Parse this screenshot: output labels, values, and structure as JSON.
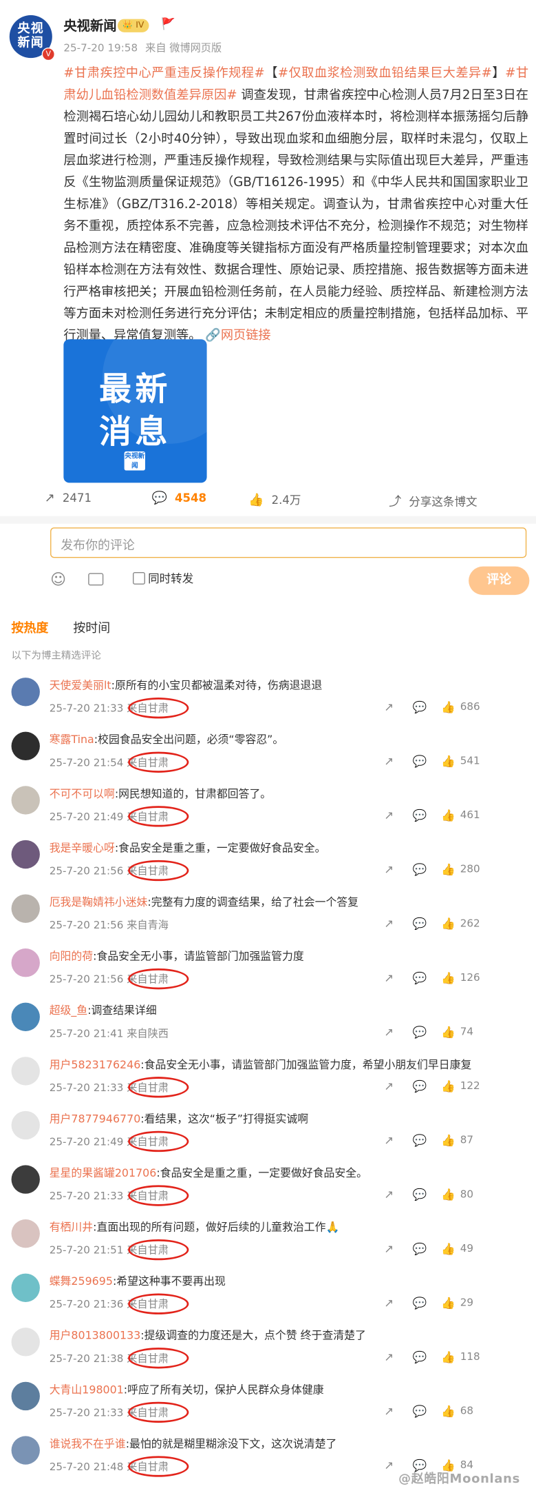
{
  "account": {
    "avatar_text_top": "央视",
    "avatar_text_bottom": "新闻",
    "name": "央视新闻",
    "level": "IV",
    "time": "25-7-20 19:58",
    "source": "来自 微博网页版"
  },
  "post": {
    "tag1": "#甘肃疾控中心严重违反操作规程#",
    "headline": "【#仅取血浆检测致血铅结果巨大差异#】",
    "tag2": "#甘肃幼儿血铅检测数值差异原因#",
    "body": " 调查发现，甘肃省疾控中心检测人员7月2日至3日在检测褐石培心幼儿园幼儿和教职员工共267份血液样本时，将检测样本振荡摇匀后静置时间过长（2小时40分钟），导致出现血浆和血细胞分层，取样时未混匀，仅取上层血浆进行检测，严重违反操作规程，导致检测结果与实际值出现巨大差异，严重违反《生物监测质量保证规范》（GB/T16126-1995）和《中华人民共和国国家职业卫生标准》（GBZ/T316.2-2018）等相关规定。调查认为，甘肃省疾控中心对重大任务不重视，质控体系不完善，应急检测技术评估不充分，检测操作不规范；对生物样品检测方法在精密度、准确度等关键指标方面没有严格质量控制管理要求；对本次血铅样本检测在方法有效性、数据合理性、原始记录、质控措施、报告数据等方面未进行严格审核把关；开展血铅检测任务前，在人员能力经验、质控样品、新建检测方法等方面未对检测任务进行充分评估；未制定相应的质量控制措施，包括样品加标、平行测量、异常值复测等。",
    "link": "网页链接",
    "card_line1": "最新",
    "card_line2": "消息",
    "card_logo": "央视新闻"
  },
  "actions": {
    "repost": "2471",
    "comment": "4548",
    "like": "2.4万",
    "share": "分享这条博文"
  },
  "composer": {
    "placeholder": "发布你的评论",
    "also_repost": "同时转发",
    "submit": "评论"
  },
  "tabs": {
    "hot": "按热度",
    "time": "按时间"
  },
  "note": "以下为博主精选评论",
  "comments": [
    {
      "name": "天使爱美丽lt",
      "text": ":原所有的小宝贝都被温柔对待，伤病退退退",
      "time": "25-7-20 21:33",
      "loc": "来自甘肃",
      "likes": "686",
      "avatar_color": "#5a7bb0",
      "circled": true
    },
    {
      "name": "寒露Tina",
      "text": ":校园食品安全出问题，必须“零容忍”。",
      "time": "25-7-20 21:54",
      "loc": "来自甘肃",
      "likes": "541",
      "avatar_color": "#2d2d2d",
      "circled": true
    },
    {
      "name": "不可不可以啊",
      "text": ":网民想知道的，甘肃都回答了。",
      "time": "25-7-20 21:49",
      "loc": "来自甘肃",
      "likes": "461",
      "avatar_color": "#c9c2b8",
      "circled": true
    },
    {
      "name": "我是辛暖心呀",
      "text": ":食品安全是重之重，一定要做好食品安全。",
      "time": "25-7-20 21:56",
      "loc": "来自甘肃",
      "likes": "280",
      "avatar_color": "#6e5a7c",
      "circled": true
    },
    {
      "name": "厄我是鞠婧祎小迷妹",
      "text": ":完整有力度的调查结果，给了社会一个答复",
      "time": "25-7-20 21:56",
      "loc": "来自青海",
      "likes": "262",
      "avatar_color": "#b9b3ad",
      "circled": false
    },
    {
      "name": "向阳的荷",
      "text": ":食品安全无小事，请监管部门加强监管力度",
      "time": "25-7-20 21:56",
      "loc": "来自甘肃",
      "likes": "126",
      "avatar_color": "#d6a7c9",
      "circled": true
    },
    {
      "name": "超级_鱼",
      "text": ":调查结果详细",
      "time": "25-7-20 21:41",
      "loc": "来自陕西",
      "likes": "74",
      "avatar_color": "#4a88b8",
      "circled": false
    },
    {
      "name": "用户5823176246",
      "text": ":食品安全无小事，请监管部门加强监管力度，希望小朋友们早日康复",
      "time": "25-7-20 21:33",
      "loc": "来自甘肃",
      "likes": "122",
      "avatar_color": "#e4e4e4",
      "circled": true
    },
    {
      "name": "用户7877946770",
      "text": ":看结果，这次“板子”打得挺实诚啊",
      "time": "25-7-20 21:49",
      "loc": "来自甘肃",
      "likes": "87",
      "avatar_color": "#e4e4e4",
      "circled": true
    },
    {
      "name": "星星的果酱罐201706",
      "text": ":食品安全是重之重，一定要做好食品安全。",
      "time": "25-7-20 21:33",
      "loc": "来自甘肃",
      "likes": "80",
      "avatar_color": "#3c3c3c",
      "circled": true
    },
    {
      "name": "有栖川井",
      "text": ":直面出现的所有问题，做好后续的儿童救治工作🙏",
      "time": "25-7-20 21:51",
      "loc": "来自甘肃",
      "likes": "49",
      "avatar_color": "#d9c3c0",
      "circled": true
    },
    {
      "name": "蝶舞259695",
      "text": ":希望这种事不要再出现",
      "time": "25-7-20 21:36",
      "loc": "来自甘肃",
      "likes": "29",
      "avatar_color": "#6fc0c8",
      "circled": true
    },
    {
      "name": "用户8013800133",
      "text": ":提级调查的力度还是大，点个赞 终于查清楚了",
      "time": "25-7-20 21:38",
      "loc": "来自甘肃",
      "likes": "118",
      "avatar_color": "#e4e4e4",
      "circled": true
    },
    {
      "name": "大青山198001",
      "text": ":呼应了所有关切，保护人民群众身体健康",
      "time": "25-7-20 21:33",
      "loc": "来自甘肃",
      "likes": "68",
      "avatar_color": "#5d7e9e",
      "circled": true
    },
    {
      "name": "谁说我不在乎谁",
      "text": ":最怕的就是糊里糊涂没下文，这次说清楚了",
      "time": "25-7-20 21:48",
      "loc": "来自甘肃",
      "likes": "84",
      "avatar_color": "#7a93b4",
      "circled": true
    }
  ],
  "watermark": "@赵皓阳Moonlans"
}
